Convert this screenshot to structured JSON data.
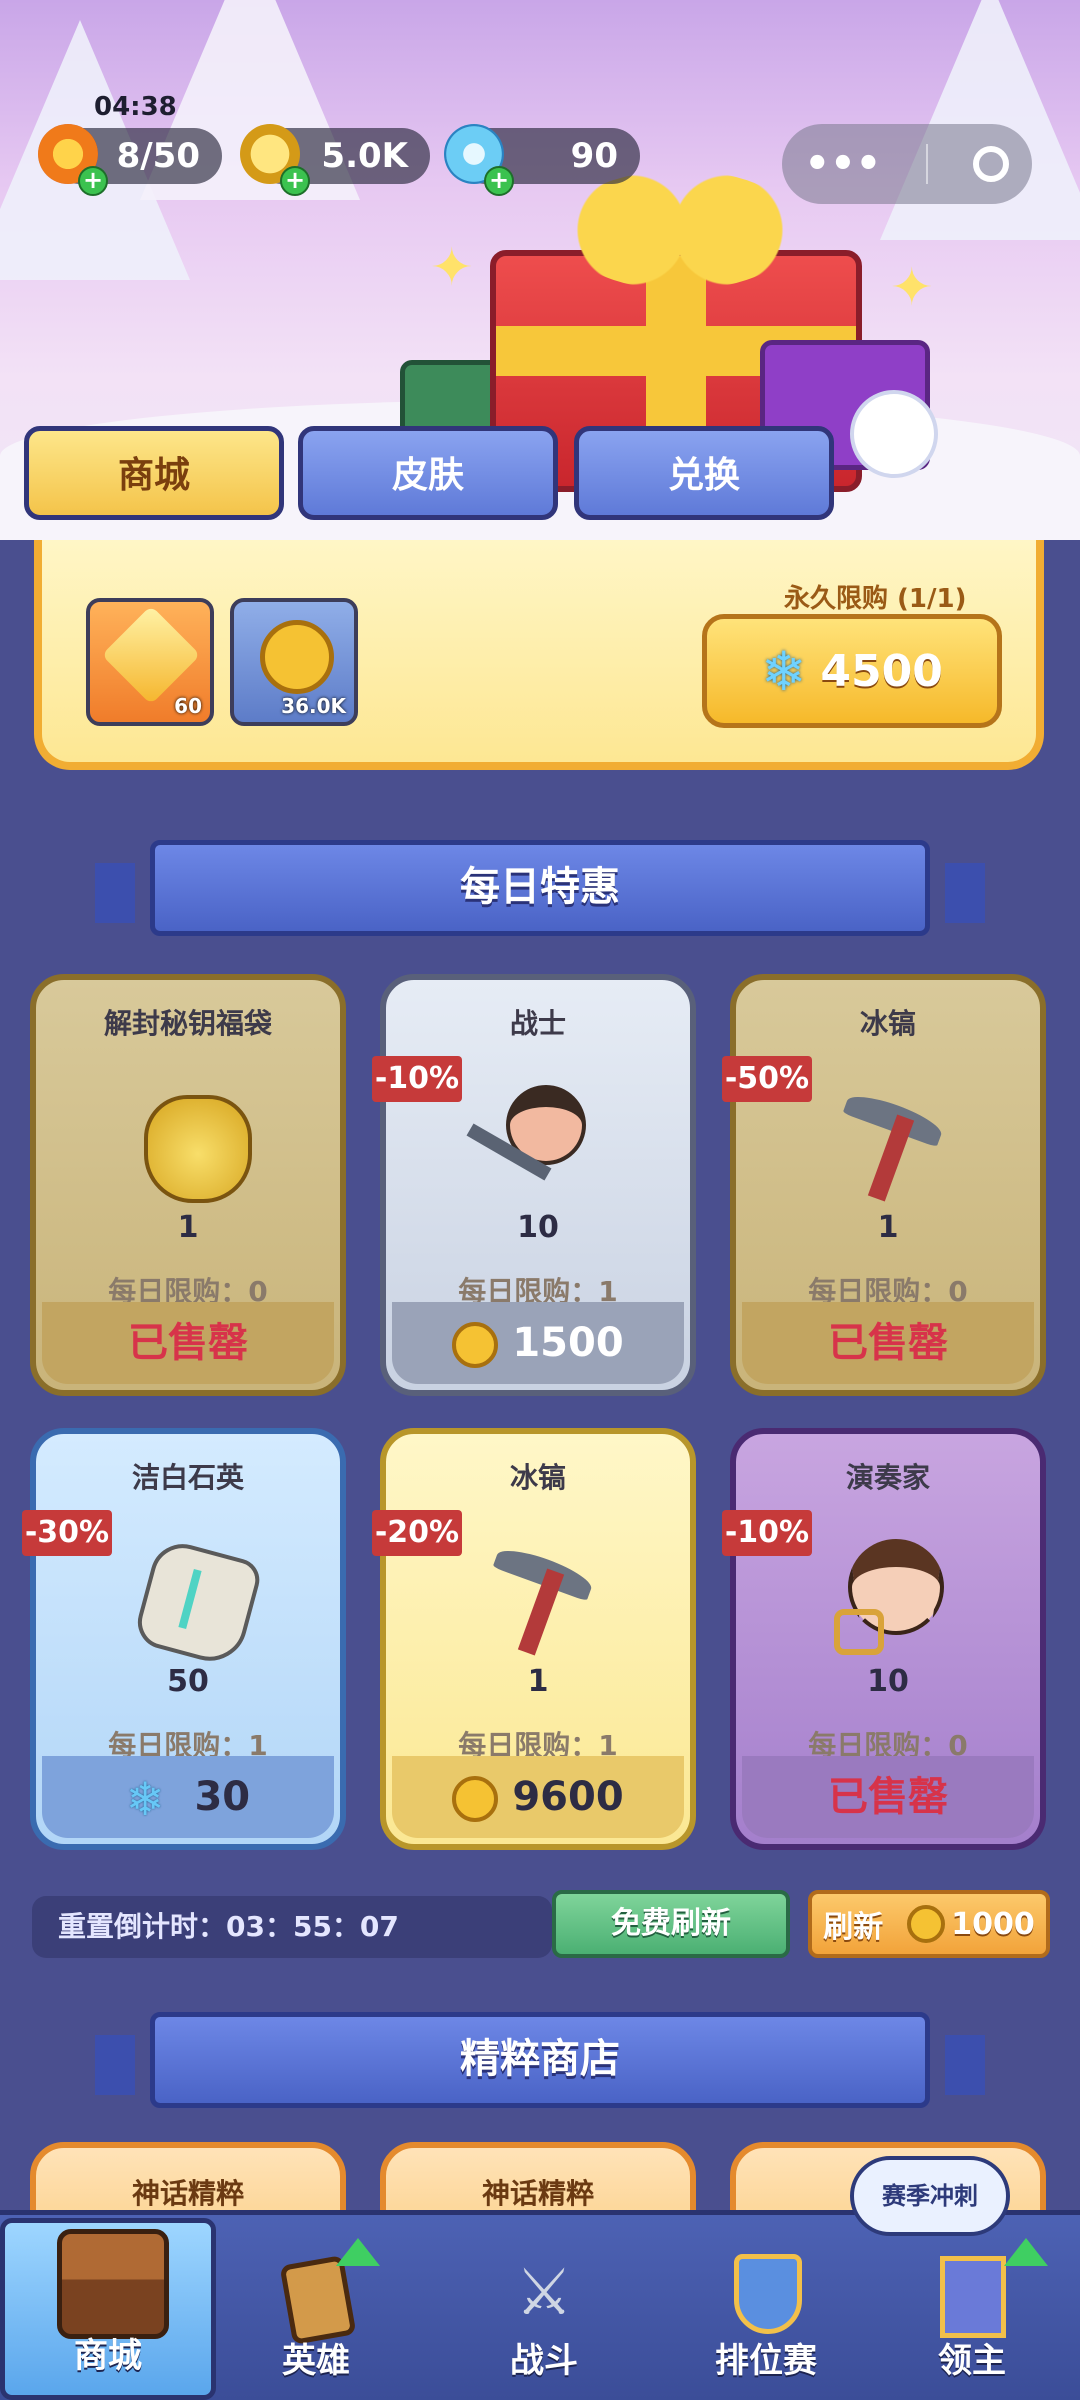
{
  "status": {
    "time": "04:38"
  },
  "resources": [
    {
      "icon": "flame-icon",
      "value": "8/50"
    },
    {
      "icon": "coin-icon",
      "value": "5.0K"
    },
    {
      "icon": "crystal-icon",
      "value": "90"
    }
  ],
  "tabs": [
    {
      "label": "商城",
      "active": true
    },
    {
      "label": "皮肤",
      "active": false
    },
    {
      "label": "兑换",
      "active": false
    }
  ],
  "permanent_offer": {
    "items": [
      {
        "icon": "gold-crystal-icon",
        "count": "60"
      },
      {
        "icon": "coin-icon",
        "count": "36.0K"
      }
    ],
    "limit": "永久限购 (1/1)",
    "price": "4500",
    "price_icon": "crystal-icon"
  },
  "daily_section": {
    "title": "每日特惠"
  },
  "daily_items": [
    {
      "name": "解封秘钥福袋",
      "icon": "lucky-bag-icon",
      "qty": "1",
      "discount": "",
      "limit": "每日限购：0",
      "footer": "已售罄",
      "sold_out": true,
      "theme": "gold"
    },
    {
      "name": "战士",
      "icon": "warrior-icon",
      "qty": "10",
      "discount": "-10%",
      "limit": "每日限购：1",
      "footer": "1500",
      "footer_icon": "coin-icon",
      "sold_out": false,
      "theme": "silver"
    },
    {
      "name": "冰镐",
      "icon": "pickaxe-icon",
      "qty": "1",
      "discount": "-50%",
      "limit": "每日限购：0",
      "footer": "已售罄",
      "sold_out": true,
      "theme": "gold"
    },
    {
      "name": "洁白石英",
      "icon": "quartz-icon",
      "qty": "50",
      "discount": "-30%",
      "limit": "每日限购：1",
      "footer": "30",
      "footer_icon": "crystal-icon",
      "sold_out": false,
      "theme": "blue"
    },
    {
      "name": "冰镐",
      "icon": "pickaxe-icon",
      "qty": "1",
      "discount": "-20%",
      "limit": "每日限购：1",
      "footer": "9600",
      "footer_icon": "coin-icon",
      "sold_out": false,
      "theme": "yellow"
    },
    {
      "name": "演奏家",
      "icon": "musician-icon",
      "qty": "10",
      "discount": "-10%",
      "limit": "每日限购：0",
      "footer": "已售罄",
      "sold_out": true,
      "theme": "purple"
    }
  ],
  "refresh": {
    "countdown": "重置倒计时：03：55：07",
    "free_label": "免费刷新",
    "paid_label": "刷新",
    "paid_cost": "1000"
  },
  "essence_section": {
    "title": "精粹商店"
  },
  "essence_items": [
    "神话精粹",
    "神话精粹",
    "神"
  ],
  "season_bubble": "赛季冲刺",
  "nav": [
    {
      "label": "商城",
      "icon": "chest-icon",
      "active": true
    },
    {
      "label": "英雄",
      "icon": "hero-card-icon",
      "active": false,
      "badge": "upgrade"
    },
    {
      "label": "战斗",
      "icon": "crossed-swords-icon",
      "active": false
    },
    {
      "label": "排位赛",
      "icon": "shield-badge-icon",
      "active": false
    },
    {
      "label": "领主",
      "icon": "lord-banner-icon",
      "active": false,
      "badge": "upgrade"
    }
  ],
  "colors": {
    "page_bg": "#4a4f8f",
    "sold_out": "#d7334a",
    "discount": "#c63a3a",
    "accent_gold": "#f4c44a"
  }
}
